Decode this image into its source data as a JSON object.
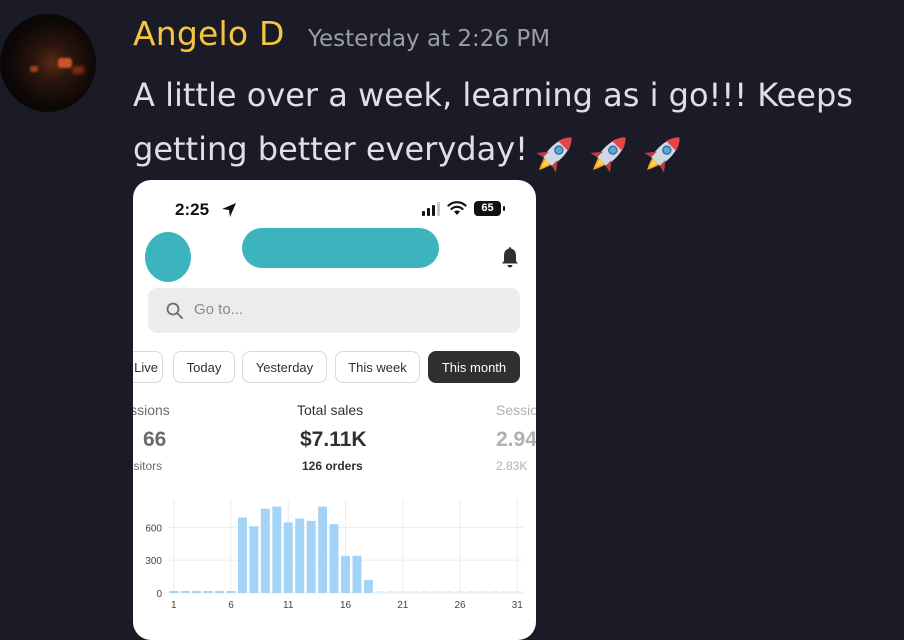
{
  "message": {
    "username": "Angelo D",
    "timestamp": "Yesterday at 2:26 PM",
    "text": "A little over a week, learning as i go!!! Keeps getting better everyday!",
    "emoji": [
      "rocket-emoji",
      "rocket-emoji",
      "rocket-emoji"
    ]
  },
  "phone": {
    "status_time": "2:25",
    "battery": "65",
    "search_placeholder": "Go to...",
    "tabs": [
      {
        "label": "Live",
        "active": false
      },
      {
        "label": "Today",
        "active": false
      },
      {
        "label": "Yesterday",
        "active": false
      },
      {
        "label": "This week",
        "active": false
      },
      {
        "label": "This month",
        "active": true
      }
    ],
    "metrics": [
      {
        "label": "Sessions",
        "value": "66",
        "sub": "Visitors"
      },
      {
        "label": "Total sales",
        "value": "$7.11K",
        "sub": "126 orders"
      },
      {
        "label": "Sessions",
        "value": "2.94",
        "sub": "2.83K"
      }
    ]
  },
  "chart_data": {
    "type": "bar",
    "x": [
      1,
      2,
      3,
      4,
      5,
      6,
      7,
      8,
      9,
      10,
      11,
      12,
      13,
      14,
      15,
      16,
      17,
      18,
      19,
      20,
      21,
      22,
      23,
      24,
      25,
      26,
      27,
      28,
      29,
      30,
      31
    ],
    "values": [
      10,
      10,
      10,
      10,
      10,
      10,
      690,
      610,
      770,
      790,
      645,
      680,
      660,
      790,
      630,
      340,
      340,
      120,
      0,
      0,
      0,
      0,
      0,
      0,
      0,
      0,
      0,
      0,
      0,
      0,
      0
    ],
    "xticks": [
      "1",
      "6",
      "11",
      "16",
      "21",
      "26",
      "31"
    ],
    "yticks": [
      "0",
      "300",
      "600"
    ],
    "ylim": [
      0,
      850
    ],
    "grid": true,
    "bar_color": "#a3d4f7"
  }
}
